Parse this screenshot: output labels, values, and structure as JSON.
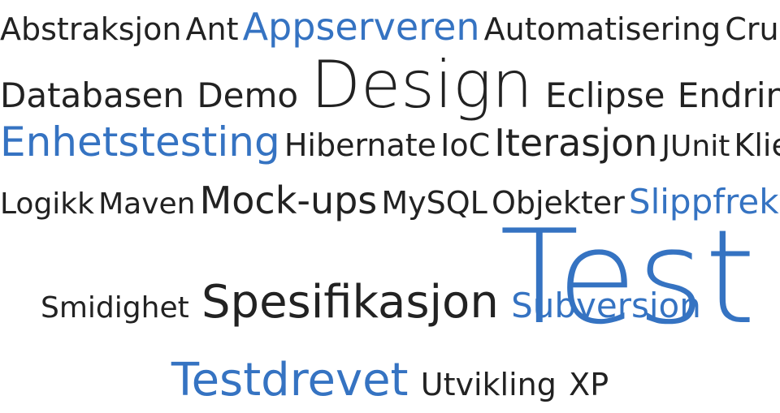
{
  "cloud": {
    "row1": {
      "t0": "Abstraksjon",
      "t1": "Ant",
      "t2": "Appserveren",
      "t3": "Automatisering",
      "t4": "Cruisecontrol"
    },
    "row2": {
      "t0": "Databasen",
      "t1": "Demo",
      "t2": "Design",
      "t3": "Eclipse",
      "t4": "Endringer"
    },
    "row3": {
      "t0": "Enhetstesting",
      "t1": "Hibernate",
      "t2": "IoC",
      "t3": "Iterasjon",
      "t4": "JUnit",
      "t5": "Klienten"
    },
    "row4": {
      "t0": "Logikk",
      "t1": "Maven",
      "t2": "Mock-ups",
      "t3": "MySQL",
      "t4": "Objekter",
      "t5": "Slippfrekvens"
    },
    "row5": {
      "t0": "Smidighet",
      "t1": "Spesifikasjon",
      "t2": "Subversion",
      "t3": "Test"
    },
    "row6": {
      "t0": "Testdrevet",
      "t1": "Utvikling",
      "t2": "XP"
    }
  }
}
